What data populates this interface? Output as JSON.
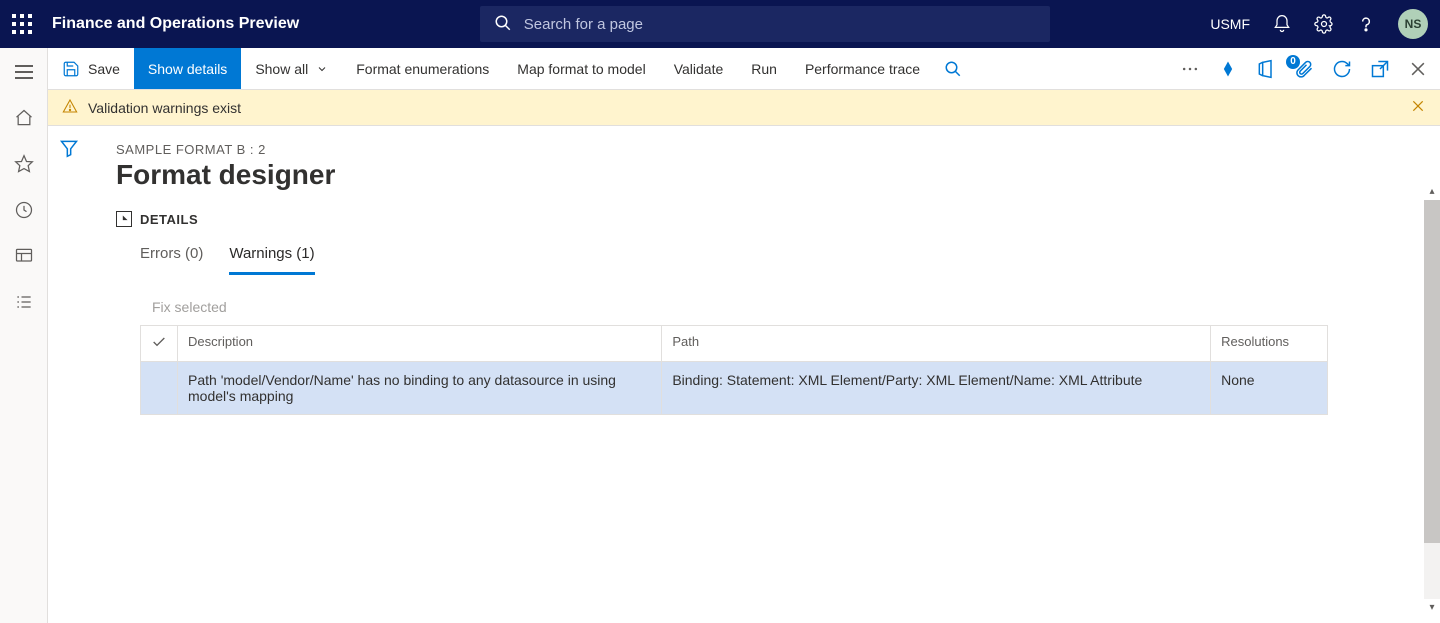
{
  "header": {
    "app_title": "Finance and Operations Preview",
    "search_placeholder": "Search for a page",
    "entity": "USMF",
    "avatar_initials": "NS"
  },
  "actionbar": {
    "save": "Save",
    "show_details": "Show details",
    "show_all": "Show all",
    "format_enumerations": "Format enumerations",
    "map_format": "Map format to model",
    "validate": "Validate",
    "run": "Run",
    "performance_trace": "Performance trace",
    "attachments_badge": "0"
  },
  "banner": {
    "text": "Validation warnings exist"
  },
  "page": {
    "breadcrumb": "SAMPLE FORMAT B : 2",
    "title": "Format designer",
    "details_label": "DETAILS"
  },
  "tabs": {
    "errors": "Errors (0)",
    "warnings": "Warnings (1)"
  },
  "fix_selected": "Fix selected",
  "table": {
    "headers": {
      "description": "Description",
      "path": "Path",
      "resolutions": "Resolutions"
    },
    "rows": [
      {
        "description": "Path 'model/Vendor/Name' has no binding to any datasource in using model's mapping",
        "path": "Binding: Statement: XML Element/Party: XML Element/Name: XML Attribute",
        "resolutions": "None"
      }
    ]
  }
}
